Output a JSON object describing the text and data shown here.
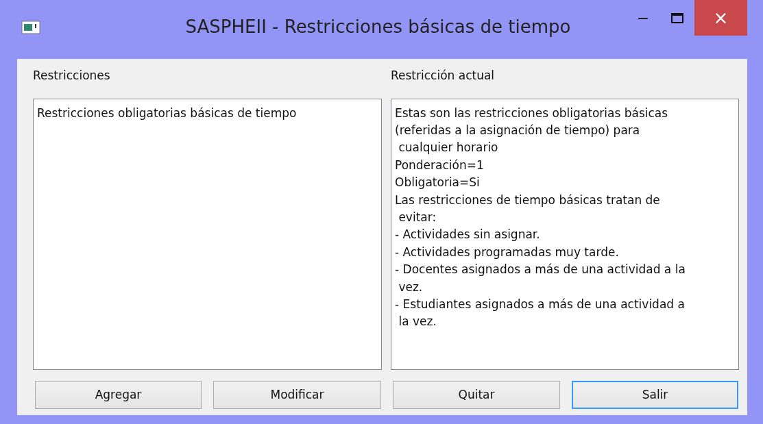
{
  "window": {
    "title": "SASPHEII - Restricciones básicas de tiempo",
    "controls": [
      "−",
      "×"
    ]
  },
  "restrictions": {
    "label": "Restricciones",
    "items": [
      {
        "text": "Restricciones obligatorias básicas de tiempo",
        "selected": false
      }
    ]
  },
  "current": {
    "label": "Restricción actual",
    "lines": [
      "Estas son las restricciones obligatorias básicas",
      "(referidas a la asignación de tiempo) para",
      " cualquier horario",
      "Ponderación=1",
      "Obligatoria=Si",
      "Las restricciones de tiempo básicas tratan de",
      " evitar:",
      "- Actividades sin asignar.",
      "- Actividades programadas muy tarde.",
      "- Docentes asignados a más de una actividad a la",
      " vez.",
      "- Estudiantes asignados a más de una actividad a",
      " la vez."
    ]
  },
  "buttons": [
    {
      "label": "Agregar",
      "default": false
    },
    {
      "label": "Modificar",
      "default": false
    },
    {
      "label": "Quitar",
      "default": false
    },
    {
      "label": "Salir",
      "default": true
    }
  ]
}
